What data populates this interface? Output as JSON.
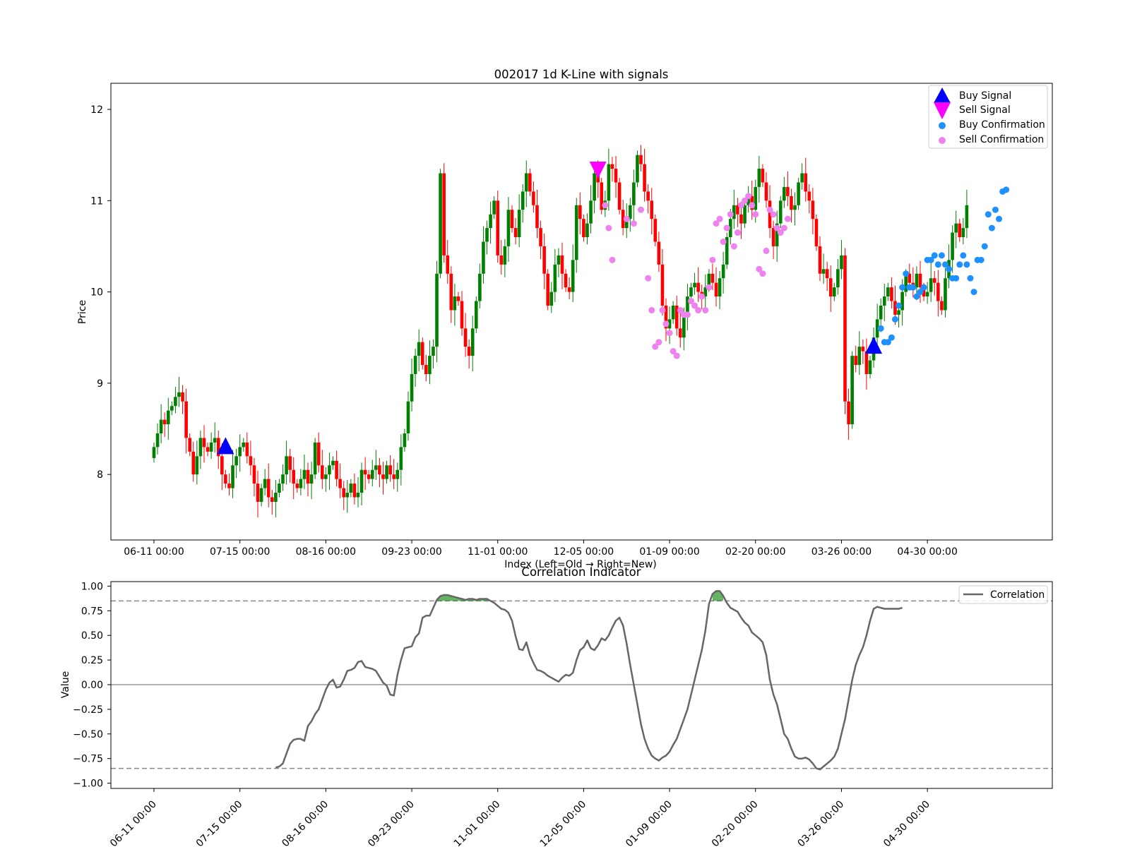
{
  "chart_data": [
    {
      "type": "candlestick",
      "title": "002017 1d K-Line with signals",
      "xlabel": "Index (Left=Old → Right=New)",
      "ylabel": "Price",
      "ylim": [
        7.28,
        12.28
      ],
      "yticks": [
        "8",
        "9",
        "10",
        "11",
        "12"
      ],
      "xticks": [
        "06-11 00:00",
        "07-15 00:00",
        "08-16 00:00",
        "09-23 00:00",
        "11-01 00:00",
        "12-05 00:00",
        "01-09 00:00",
        "02-20 00:00",
        "03-26 00:00",
        "04-30 00:00"
      ],
      "xtick_index": [
        0,
        24,
        48,
        72,
        96,
        120,
        144,
        168,
        192,
        216
      ],
      "colors": {
        "up": "#008000",
        "down": "#ff0000"
      },
      "legend": {
        "position": "top-right",
        "entries": [
          "Buy Signal",
          "Sell Signal",
          "Buy Confirmation",
          "Sell Confirmation"
        ],
        "colors": [
          "#0000ff",
          "#ff00ff",
          "#1e90ff",
          "#ee82ee"
        ]
      },
      "close": [
        8.3,
        8.45,
        8.6,
        8.55,
        8.7,
        8.75,
        8.85,
        8.9,
        8.8,
        8.4,
        8.25,
        8.0,
        8.2,
        8.4,
        8.3,
        8.25,
        8.35,
        8.4,
        8.2,
        8.0,
        7.9,
        7.85,
        8.1,
        8.2,
        8.3,
        8.35,
        8.2,
        8.1,
        7.9,
        7.7,
        7.85,
        7.95,
        7.75,
        7.7,
        7.8,
        7.9,
        8.0,
        8.2,
        8.05,
        7.9,
        7.85,
        7.95,
        8.05,
        7.9,
        8.0,
        8.35,
        8.1,
        7.95,
        8.0,
        8.1,
        8.15,
        7.95,
        7.85,
        7.75,
        7.8,
        7.9,
        7.75,
        7.8,
        8.05,
        8.0,
        7.95,
        8.05,
        8.1,
        8.0,
        7.95,
        8.1,
        8.0,
        7.95,
        8.05,
        8.3,
        8.45,
        8.8,
        9.1,
        9.3,
        9.45,
        9.2,
        9.1,
        9.3,
        9.4,
        10.2,
        11.3,
        10.4,
        10.2,
        9.8,
        9.95,
        9.9,
        9.6,
        9.4,
        9.3,
        9.6,
        9.9,
        10.2,
        10.55,
        10.7,
        10.85,
        11.0,
        10.4,
        10.3,
        10.5,
        10.9,
        10.7,
        10.6,
        10.9,
        11.1,
        11.3,
        11.1,
        10.95,
        10.7,
        10.5,
        10.2,
        9.85,
        10.0,
        10.3,
        10.4,
        10.2,
        10.05,
        10.0,
        10.35,
        10.95,
        10.8,
        10.6,
        10.75,
        11.0,
        11.3,
        11.2,
        10.9,
        11.0,
        11.4,
        11.35,
        11.2,
        10.9,
        10.7,
        10.8,
        10.95,
        11.2,
        11.5,
        11.4,
        11.1,
        11.0,
        10.8,
        10.55,
        10.3,
        9.85,
        9.6,
        9.7,
        9.85,
        9.6,
        9.5,
        9.75,
        9.95,
        10.05,
        10.1,
        10.0,
        9.95,
        10.05,
        10.2,
        10.1,
        9.95,
        10.15,
        10.3,
        10.6,
        10.8,
        10.95,
        10.85,
        10.75,
        10.95,
        11.05,
        10.9,
        11.15,
        11.35,
        11.2,
        11.0,
        10.7,
        10.5,
        10.75,
        11.0,
        11.15,
        11.05,
        10.9,
        10.95,
        11.2,
        11.3,
        11.1,
        11.0,
        10.8,
        10.5,
        10.2,
        10.25,
        10.15,
        9.95,
        10.05,
        10.25,
        10.4,
        8.8,
        8.55,
        9.3,
        9.2,
        9.4,
        9.35,
        9.1,
        9.25,
        9.5,
        9.7,
        9.85,
        9.95,
        10.05,
        9.9,
        9.75,
        9.8,
        10.0,
        10.2,
        10.1,
        10.05,
        10.2,
        10.05,
        9.95,
        10.0,
        10.15,
        10.1,
        9.9,
        9.8,
        10.15,
        10.35,
        10.65,
        10.75,
        10.6,
        10.7,
        10.95
      ],
      "series": [
        {
          "name": "Buy Signal",
          "marker": "triangle-up",
          "color": "#0000ff",
          "points": [
            {
              "i": 20,
              "y": 8.3
            },
            {
              "i": 201,
              "y": 9.4
            }
          ]
        },
        {
          "name": "Sell Signal",
          "marker": "triangle-down",
          "color": "#ff00ff",
          "points": [
            {
              "i": 124,
              "y": 11.35
            }
          ]
        },
        {
          "name": "Buy Confirmation",
          "marker": "circle",
          "color": "#1e90ff",
          "points": [
            {
              "i": 203,
              "y": 9.6
            },
            {
              "i": 204,
              "y": 9.45
            },
            {
              "i": 205,
              "y": 9.45
            },
            {
              "i": 206,
              "y": 9.5
            },
            {
              "i": 207,
              "y": 9.7
            },
            {
              "i": 208,
              "y": 9.85
            },
            {
              "i": 209,
              "y": 10.05
            },
            {
              "i": 210,
              "y": 10.2
            },
            {
              "i": 211,
              "y": 10.05
            },
            {
              "i": 212,
              "y": 10.05
            },
            {
              "i": 213,
              "y": 9.95
            },
            {
              "i": 214,
              "y": 10.0
            },
            {
              "i": 215,
              "y": 10.05
            },
            {
              "i": 216,
              "y": 10.35
            },
            {
              "i": 217,
              "y": 10.35
            },
            {
              "i": 218,
              "y": 10.4
            },
            {
              "i": 219,
              "y": 10.3
            },
            {
              "i": 220,
              "y": 10.4
            },
            {
              "i": 221,
              "y": 10.3
            },
            {
              "i": 222,
              "y": 10.25
            },
            {
              "i": 223,
              "y": 10.15
            },
            {
              "i": 224,
              "y": 10.15
            },
            {
              "i": 225,
              "y": 10.3
            },
            {
              "i": 226,
              "y": 10.4
            },
            {
              "i": 227,
              "y": 10.3
            },
            {
              "i": 228,
              "y": 10.15
            },
            {
              "i": 229,
              "y": 10.0
            },
            {
              "i": 230,
              "y": 10.35
            },
            {
              "i": 231,
              "y": 10.35
            },
            {
              "i": 232,
              "y": 10.5
            },
            {
              "i": 233,
              "y": 10.85
            },
            {
              "i": 234,
              "y": 10.7
            },
            {
              "i": 235,
              "y": 10.9
            },
            {
              "i": 236,
              "y": 10.8
            },
            {
              "i": 237,
              "y": 11.1
            },
            {
              "i": 238,
              "y": 11.12
            }
          ]
        },
        {
          "name": "Sell Confirmation",
          "marker": "circle",
          "color": "#ee82ee",
          "points": [
            {
              "i": 126,
              "y": 10.95
            },
            {
              "i": 127,
              "y": 10.7
            },
            {
              "i": 128,
              "y": 10.35
            },
            {
              "i": 132,
              "y": 10.8
            },
            {
              "i": 134,
              "y": 10.75
            },
            {
              "i": 136,
              "y": 10.9
            },
            {
              "i": 138,
              "y": 10.15
            },
            {
              "i": 139,
              "y": 9.8
            },
            {
              "i": 140,
              "y": 9.4
            },
            {
              "i": 141,
              "y": 9.45
            },
            {
              "i": 142,
              "y": 9.8
            },
            {
              "i": 143,
              "y": 9.65
            },
            {
              "i": 144,
              "y": 9.55
            },
            {
              "i": 145,
              "y": 9.35
            },
            {
              "i": 146,
              "y": 9.3
            },
            {
              "i": 147,
              "y": 9.8
            },
            {
              "i": 148,
              "y": 9.75
            },
            {
              "i": 149,
              "y": 9.75
            },
            {
              "i": 150,
              "y": 9.9
            },
            {
              "i": 151,
              "y": 9.85
            },
            {
              "i": 152,
              "y": 9.8
            },
            {
              "i": 153,
              "y": 9.95
            },
            {
              "i": 154,
              "y": 9.8
            },
            {
              "i": 155,
              "y": 10.05
            },
            {
              "i": 156,
              "y": 10.35
            },
            {
              "i": 157,
              "y": 10.75
            },
            {
              "i": 158,
              "y": 10.8
            },
            {
              "i": 159,
              "y": 10.55
            },
            {
              "i": 160,
              "y": 10.7
            },
            {
              "i": 161,
              "y": 10.85
            },
            {
              "i": 162,
              "y": 10.5
            },
            {
              "i": 163,
              "y": 10.65
            },
            {
              "i": 164,
              "y": 10.95
            },
            {
              "i": 165,
              "y": 11.0
            },
            {
              "i": 166,
              "y": 11.05
            },
            {
              "i": 167,
              "y": 10.95
            },
            {
              "i": 168,
              "y": 10.85
            },
            {
              "i": 169,
              "y": 10.25
            },
            {
              "i": 170,
              "y": 10.2
            },
            {
              "i": 171,
              "y": 10.45
            },
            {
              "i": 172,
              "y": 10.9
            },
            {
              "i": 173,
              "y": 10.85
            },
            {
              "i": 174,
              "y": 10.7
            },
            {
              "i": 175,
              "y": 10.65
            },
            {
              "i": 176,
              "y": 10.7
            },
            {
              "i": 177,
              "y": 10.8
            }
          ]
        }
      ]
    },
    {
      "type": "line",
      "title": "Correlation Indicator",
      "xlabel": "",
      "ylabel": "Value",
      "ylim": [
        -1.05,
        1.05
      ],
      "yticks": [
        "1.00",
        "0.75",
        "0.50",
        "0.25",
        "0.00",
        "−0.25",
        "−0.50",
        "−0.75",
        "−1.00"
      ],
      "xticks": [
        "06-11 00:00",
        "07-15 00:00",
        "08-16 00:00",
        "09-23 00:00",
        "11-01 00:00",
        "12-05 00:00",
        "01-09 00:00",
        "02-20 00:00",
        "03-26 00:00",
        "04-30 00:00"
      ],
      "hlines": [
        0.85,
        -0.85
      ],
      "zero_line": 0.0,
      "legend": {
        "position": "top-right",
        "entries": [
          "Correlation"
        ]
      },
      "series": [
        {
          "name": "Correlation",
          "color": "#666666",
          "start_index": 34,
          "values": [
            -0.84,
            -0.83,
            -0.8,
            -0.7,
            -0.6,
            -0.56,
            -0.55,
            -0.55,
            -0.57,
            -0.42,
            -0.37,
            -0.3,
            -0.25,
            -0.15,
            -0.05,
            0.02,
            0.05,
            -0.03,
            -0.02,
            0.05,
            0.14,
            0.15,
            0.17,
            0.23,
            0.24,
            0.18,
            0.17,
            0.16,
            0.14,
            0.08,
            0.02,
            -0.01,
            -0.1,
            -0.11,
            0.1,
            0.25,
            0.37,
            0.38,
            0.39,
            0.48,
            0.52,
            0.68,
            0.7,
            0.7,
            0.78,
            0.86,
            0.9,
            0.91,
            0.91,
            0.9,
            0.89,
            0.88,
            0.87,
            0.86,
            0.87,
            0.87,
            0.86,
            0.87,
            0.87,
            0.87,
            0.85,
            0.83,
            0.8,
            0.77,
            0.76,
            0.73,
            0.65,
            0.49,
            0.36,
            0.35,
            0.43,
            0.3,
            0.22,
            0.15,
            0.14,
            0.12,
            0.09,
            0.07,
            0.05,
            0.03,
            0.07,
            0.1,
            0.09,
            0.12,
            0.25,
            0.35,
            0.38,
            0.45,
            0.37,
            0.35,
            0.4,
            0.47,
            0.45,
            0.5,
            0.58,
            0.65,
            0.68,
            0.6,
            0.42,
            0.2,
            0.0,
            -0.2,
            -0.4,
            -0.55,
            -0.65,
            -0.72,
            -0.75,
            -0.77,
            -0.74,
            -0.72,
            -0.68,
            -0.61,
            -0.55,
            -0.45,
            -0.35,
            -0.25,
            -0.1,
            0.05,
            0.2,
            0.35,
            0.55,
            0.82,
            0.92,
            0.95,
            0.95,
            0.9,
            0.83,
            0.78,
            0.76,
            0.74,
            0.68,
            0.63,
            0.6,
            0.53,
            0.5,
            0.47,
            0.43,
            0.3,
            0.05,
            -0.1,
            -0.2,
            -0.35,
            -0.5,
            -0.55,
            -0.65,
            -0.73,
            -0.75,
            -0.75,
            -0.74,
            -0.76,
            -0.8,
            -0.85,
            -0.86,
            -0.83,
            -0.8,
            -0.77,
            -0.73,
            -0.65,
            -0.5,
            -0.35,
            -0.15,
            0.05,
            0.2,
            0.3,
            0.38,
            0.5,
            0.65,
            0.77,
            0.79,
            0.78,
            0.77,
            0.77,
            0.77,
            0.77,
            0.77,
            0.78
          ]
        }
      ]
    }
  ]
}
